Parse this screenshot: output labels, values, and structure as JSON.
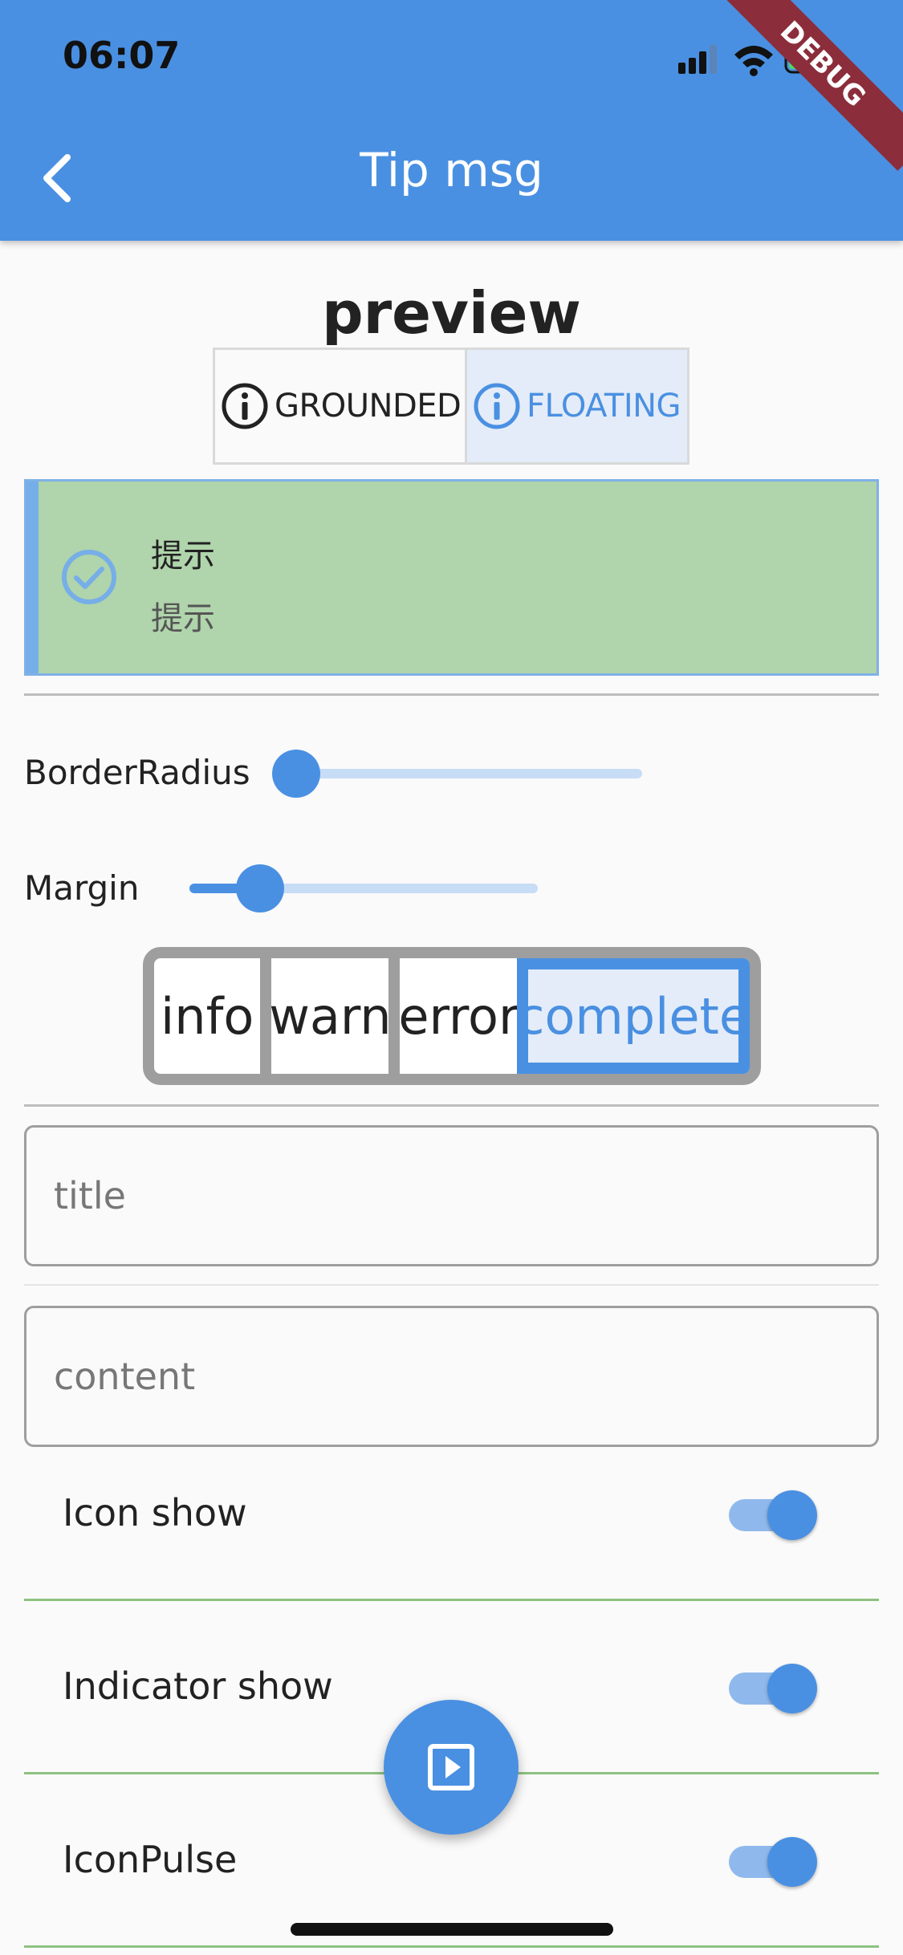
{
  "status_bar": {
    "time": "06:07",
    "debug_banner": "DEBUG"
  },
  "app_bar": {
    "title": "Tip msg",
    "back_icon": "chevron-left-icon"
  },
  "preview": {
    "heading": "preview",
    "style_options": [
      {
        "label": "GROUNDED",
        "icon": "info-icon",
        "selected": false
      },
      {
        "label": "FLOATING",
        "icon": "info-icon",
        "selected": true
      }
    ],
    "tip": {
      "title": "提示",
      "content": "提示",
      "icon": "check-circle-icon",
      "background_color": "#b0d4ab",
      "indicator_color": "#76aee8"
    }
  },
  "sliders": [
    {
      "label": "BorderRadius",
      "value": 0.0
    },
    {
      "label": "Margin",
      "value": 0.2
    }
  ],
  "types": {
    "options": [
      "info",
      "warn",
      "error",
      "complete"
    ],
    "selected": "complete"
  },
  "fields": {
    "title_placeholder": "title",
    "content_placeholder": "content"
  },
  "switches": [
    {
      "label": "Icon show",
      "on": true
    },
    {
      "label": "Indicator show",
      "on": true
    },
    {
      "label": "IconPulse",
      "on": true
    }
  ],
  "fab": {
    "icon": "play-icon"
  },
  "colors": {
    "accent": "#4a90e2"
  }
}
